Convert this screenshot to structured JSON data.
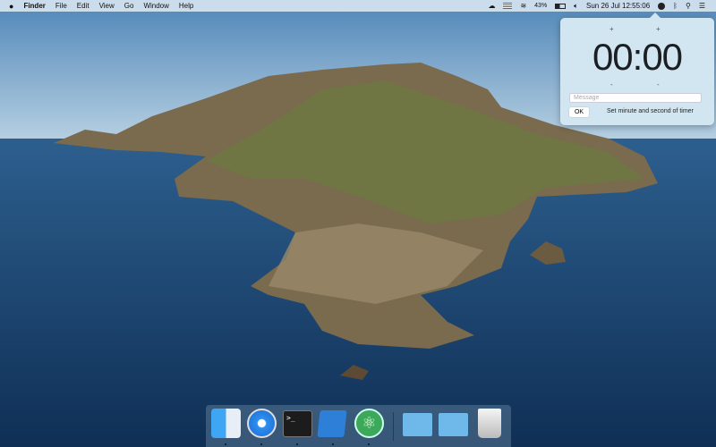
{
  "menubar": {
    "apple": "",
    "app": "Finder",
    "items": [
      "File",
      "Edit",
      "View",
      "Go",
      "Window",
      "Help"
    ],
    "status": {
      "battery": "43%",
      "datetime": "Sun 26 Jul  12:55:06"
    }
  },
  "timer": {
    "plus": "+",
    "minus": "-",
    "time": "00:00",
    "message_placeholder": "Message",
    "ok": "OK",
    "hint": "Set minute and second of timer"
  },
  "dock": {
    "apps": [
      "Finder",
      "Safari",
      "Terminal",
      "Xcode",
      "Atom"
    ],
    "folders": [
      "iCloud Drive",
      "Downloads"
    ],
    "trash": "Trash",
    "terminal_prompt": ">_"
  }
}
